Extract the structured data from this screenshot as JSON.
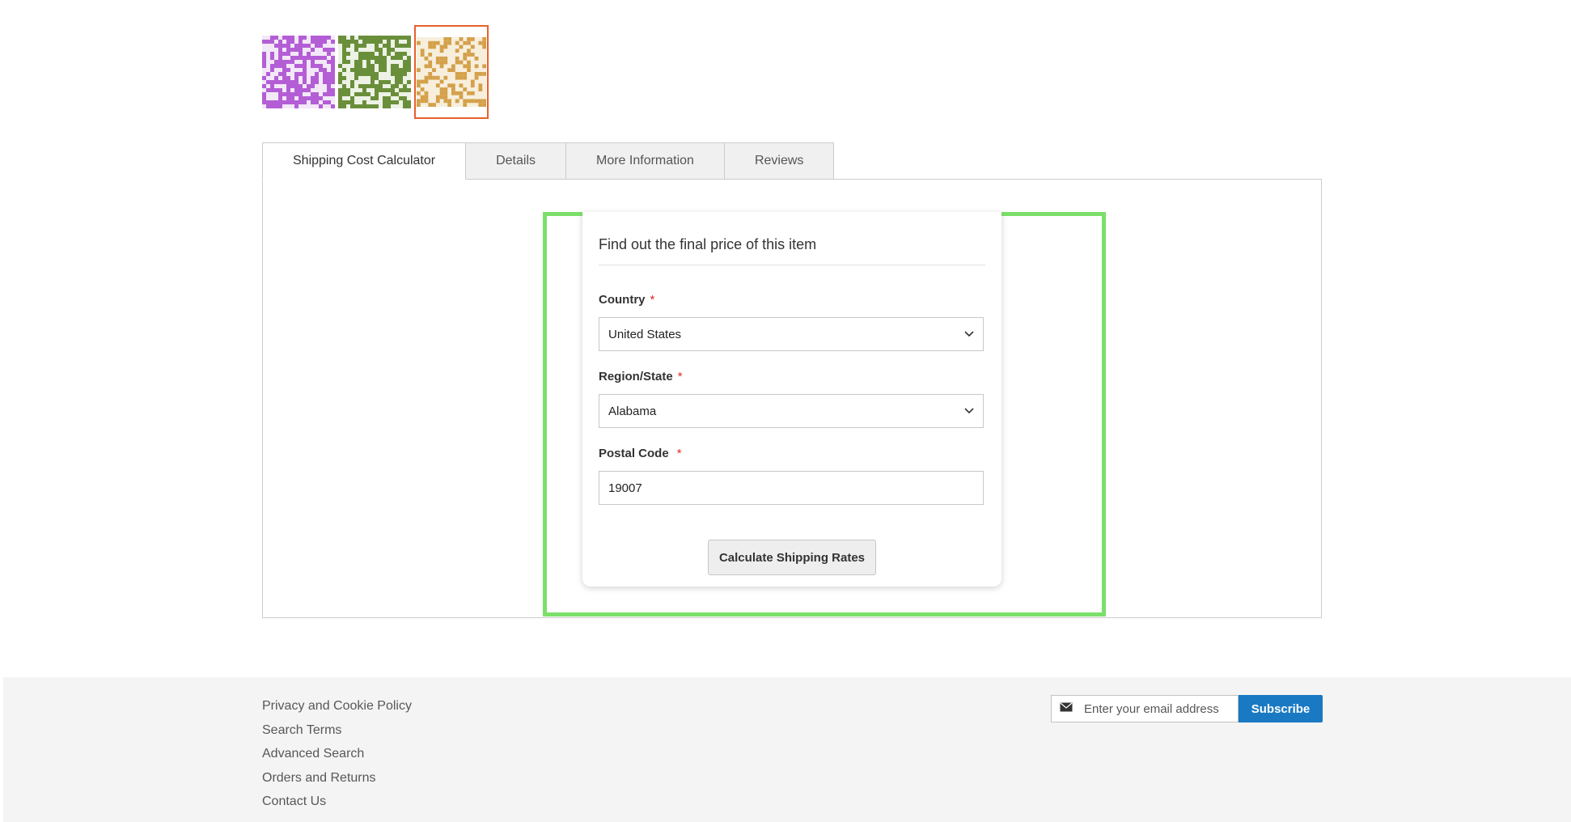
{
  "gallery": {
    "thumbnails": [
      {
        "name": "purple-pattern-thumbnail",
        "color": "#b45ed6",
        "active": false
      },
      {
        "name": "green-pattern-thumbnail",
        "color": "#6a8f3a",
        "active": false
      },
      {
        "name": "gold-pattern-thumbnail",
        "color": "#d4a04a",
        "active": true
      }
    ],
    "active_border_color": "#e8602c"
  },
  "tabs": [
    {
      "label": "Shipping Cost Calculator",
      "active": true
    },
    {
      "label": "Details",
      "active": false
    },
    {
      "label": "More Information",
      "active": false
    },
    {
      "label": "Reviews",
      "active": false
    }
  ],
  "calculator": {
    "title": "Find out the final price of this item",
    "country_label": "Country",
    "country_value": "United States",
    "region_label": "Region/State",
    "region_value": "Alabama",
    "postal_label": "Postal Code",
    "postal_value": "19007",
    "required_mark": "*",
    "button_label": "Calculate Shipping Rates",
    "highlight_color": "#7be06a"
  },
  "footer": {
    "links": [
      "Privacy and Cookie Policy",
      "Search Terms",
      "Advanced Search",
      "Orders and Returns",
      "Contact Us"
    ],
    "newsletter": {
      "placeholder": "Enter your email address",
      "button_label": "Subscribe",
      "icon": "envelope-icon",
      "button_color": "#1979c3"
    }
  }
}
